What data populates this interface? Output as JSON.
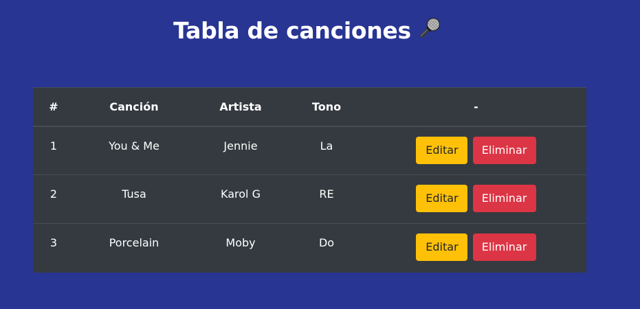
{
  "page": {
    "title": "Tabla de canciones",
    "title_icon": "microphone-icon"
  },
  "table": {
    "headers": [
      "#",
      "Canción",
      "Artista",
      "Tono",
      "-"
    ],
    "rows": [
      {
        "num": "1",
        "song": "You & Me",
        "artist": "Jennie",
        "key": "La"
      },
      {
        "num": "2",
        "song": "Tusa",
        "artist": "Karol G",
        "key": "RE"
      },
      {
        "num": "3",
        "song": "Porcelain",
        "artist": "Moby",
        "key": "Do"
      }
    ],
    "edit_label": "Editar",
    "delete_label": "Eliminar"
  },
  "colors": {
    "background": "#283593",
    "table_bg": "#343a40",
    "edit_button": "#ffc107",
    "delete_button": "#dc3545"
  }
}
